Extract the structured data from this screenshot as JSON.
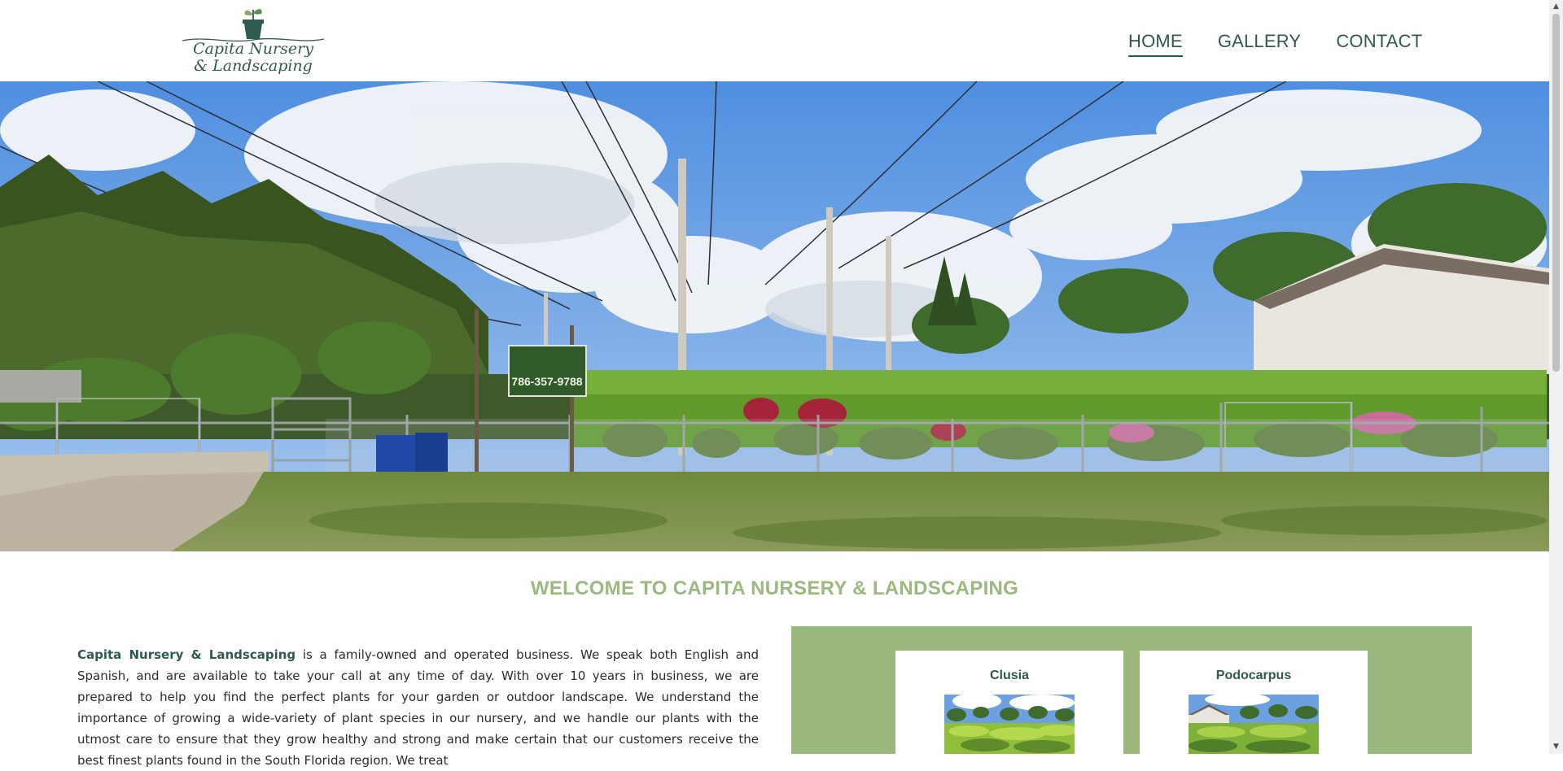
{
  "brand": {
    "line1": "Capita Nursery",
    "line2": "& Landscaping"
  },
  "nav": {
    "items": [
      {
        "label": "HOME",
        "active": true
      },
      {
        "label": "GALLERY",
        "active": false
      },
      {
        "label": "CONTACT",
        "active": false
      }
    ]
  },
  "hero": {
    "sign_text": "786-357-9788"
  },
  "welcome": {
    "title": "WELCOME TO CAPITA NURSERY & LANDSCAPING"
  },
  "about": {
    "company": "Capita Nursery & Landscaping",
    "text": " is a family-owned and operated business. We speak both English and Spanish, and are available to take your call at any time of day. With over 10 years in business, we are prepared to help you find the perfect plants for your garden or outdoor landscape. We understand the importance of growing a wide-variety of plant species in our nursery, and we handle our plants with the utmost care to ensure that they grow healthy and strong and make certain that our customers receive the best finest plants found in the South Florida region. We treat"
  },
  "plants": [
    {
      "name": "Clusia"
    },
    {
      "name": "Podocarpus"
    }
  ],
  "colors": {
    "brand_green": "#2f5a4f",
    "accent_green": "#9bb97f"
  },
  "icons": {
    "logo": "potted-plant-icon",
    "scroll_up": "scroll-up-arrow-icon",
    "scroll_down": "scroll-down-arrow-icon"
  }
}
